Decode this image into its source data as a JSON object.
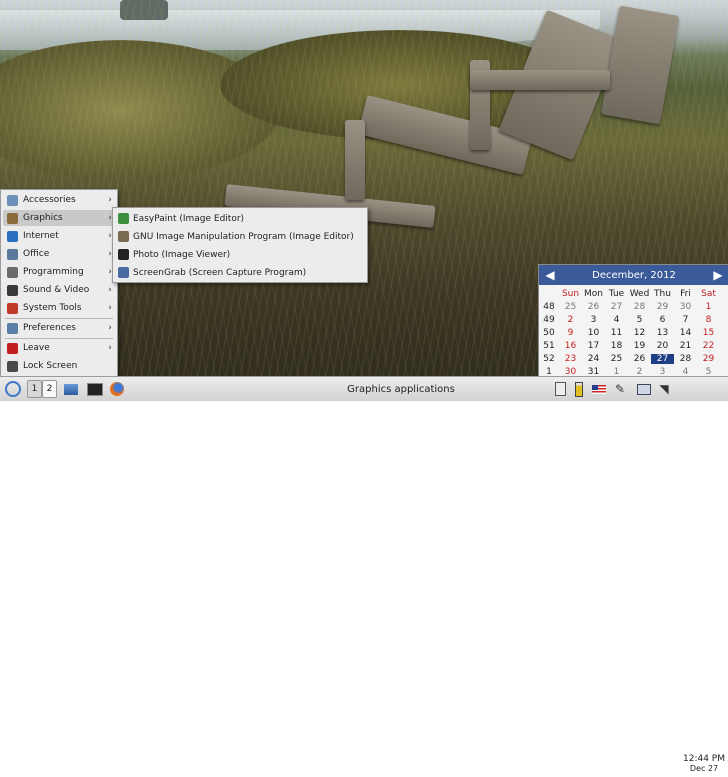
{
  "menu": {
    "items": [
      {
        "label": "Accessories",
        "icon": "accessories-icon",
        "color": "#6d8fb8",
        "has_submenu": true
      },
      {
        "label": "Graphics",
        "icon": "graphics-icon",
        "color": "#8b6a3c",
        "has_submenu": true,
        "active": true
      },
      {
        "label": "Internet",
        "icon": "internet-icon",
        "color": "#2a6fc0",
        "has_submenu": true
      },
      {
        "label": "Office",
        "icon": "office-icon",
        "color": "#5a7a9c",
        "has_submenu": true
      },
      {
        "label": "Programming",
        "icon": "programming-icon",
        "color": "#6b6b6b",
        "has_submenu": true
      },
      {
        "label": "Sound & Video",
        "icon": "sound-video-icon",
        "color": "#3a3a3a",
        "has_submenu": true
      },
      {
        "label": "System Tools",
        "icon": "system-tools-icon",
        "color": "#c03a2a",
        "has_submenu": true
      },
      {
        "label": "Preferences",
        "icon": "preferences-icon",
        "color": "#5b7fa6",
        "has_submenu": true
      },
      {
        "label": "Leave",
        "icon": "leave-icon",
        "color": "#c02020",
        "has_submenu": true
      },
      {
        "label": "Lock Screen",
        "icon": "lock-screen-icon",
        "color": "#4a4a4a",
        "has_submenu": false
      }
    ]
  },
  "submenu": {
    "items": [
      {
        "label": "EasyPaint (Image Editor)",
        "icon": "easypaint-icon",
        "color": "#3d8f3d"
      },
      {
        "label": "GNU Image Manipulation Program (Image Editor)",
        "icon": "gimp-icon",
        "color": "#7a6a50"
      },
      {
        "label": "Photo (Image Viewer)",
        "icon": "photo-viewer-icon",
        "color": "#222222"
      },
      {
        "label": "ScreenGrab (Screen Capture Program)",
        "icon": "screengrab-icon",
        "color": "#4a6aa0"
      }
    ]
  },
  "calendar": {
    "month_label": "December,  2012",
    "weekdays": [
      "Sun",
      "Mon",
      "Tue",
      "Wed",
      "Thu",
      "Fri",
      "Sat"
    ],
    "weeks": [
      {
        "wk": "48",
        "days": [
          "25",
          "26",
          "27",
          "28",
          "29",
          "30",
          "1"
        ]
      },
      {
        "wk": "49",
        "days": [
          "2",
          "3",
          "4",
          "5",
          "6",
          "7",
          "8"
        ]
      },
      {
        "wk": "50",
        "days": [
          "9",
          "10",
          "11",
          "12",
          "13",
          "14",
          "15"
        ]
      },
      {
        "wk": "51",
        "days": [
          "16",
          "17",
          "18",
          "19",
          "20",
          "21",
          "22"
        ]
      },
      {
        "wk": "52",
        "days": [
          "23",
          "24",
          "25",
          "26",
          "27",
          "28",
          "29"
        ]
      },
      {
        "wk": "1",
        "days": [
          "30",
          "31",
          "1",
          "2",
          "3",
          "4",
          "5"
        ]
      }
    ],
    "today": "27",
    "header_color": "#3b5a9a",
    "weekend_color": "#c41e1e"
  },
  "taskbar": {
    "desktops": [
      "1",
      "2"
    ],
    "active_desktop": "1",
    "window_title": "Graphics applications",
    "clock_time": "12:44 PM",
    "clock_date": "Dec 27"
  }
}
